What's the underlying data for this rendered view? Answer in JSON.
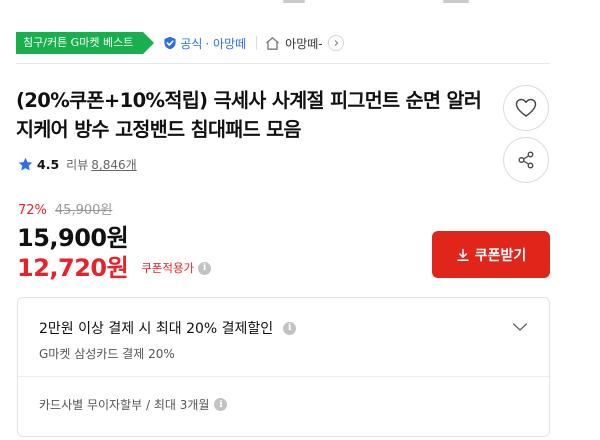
{
  "badges": {
    "best": "침구/커튼 G마켓 베스트",
    "official_label": "공식",
    "official_brand": "· 아망떼",
    "store_name": "아망떼-"
  },
  "product": {
    "title": "(20%쿠폰+10%적립) 극세사 사계절 피그먼트 순면 알러지케어 방수 고정밴드 침대패드 모음"
  },
  "rating": {
    "score": "4.5",
    "review_label": "리뷰",
    "review_count": "8,846개"
  },
  "pricing": {
    "discount_rate": "72%",
    "original_price": "45,900원",
    "sale_price": "15,900원",
    "coupon_price": "12,720원",
    "coupon_label": "쿠폰적용가"
  },
  "actions": {
    "coupon_button": "쿠폰받기"
  },
  "payment_benefit": {
    "headline": "2만원 이상 결제 시 최대 20% 결제할인",
    "sub": "G마켓 삼성카드 결제 20%",
    "installment": "카드사별 무이자할부 / 최대 3개월"
  },
  "icons": {
    "info_glyph": "i"
  },
  "colors": {
    "best_badge": "#18b04d",
    "official_blue": "#2e6fe3",
    "sale_red": "#e8212a",
    "coupon_button": "#e0251b"
  }
}
